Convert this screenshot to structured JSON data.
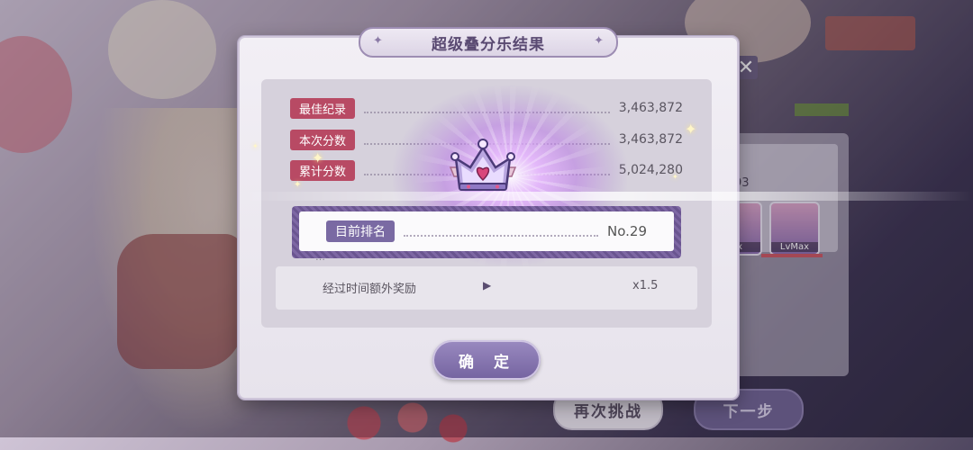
{
  "dialog": {
    "title": "超级叠分乐结果",
    "stats": [
      {
        "label": "最佳纪录",
        "value": "3,463,872"
      },
      {
        "label": "本次分数",
        "value": "3,463,872"
      },
      {
        "label": "累计分数",
        "value": "5,024,280"
      }
    ],
    "rank": {
      "label": "目前排名",
      "value": "No.29"
    },
    "bonus": {
      "label": "经过时间额外奖励",
      "arrow": "▶",
      "value": "x1.5"
    },
    "confirm_label": "确 定"
  },
  "background": {
    "retry_label": "再次挑战",
    "next_label": "下一步",
    "close_glyph": "✕",
    "card_levels": [
      "ax",
      "LvMax"
    ],
    "partial_score": "93"
  },
  "colors": {
    "stat_tag": "#b84a64",
    "rank_tag": "#7a6aa3",
    "accent": "#7463a0"
  }
}
